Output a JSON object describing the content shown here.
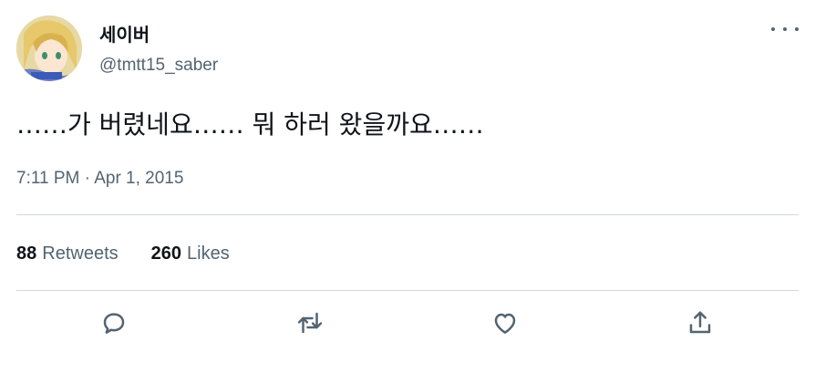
{
  "user": {
    "display_name": "세이버",
    "handle": "@tmtt15_saber",
    "avatar": "anime-character-avatar"
  },
  "tweet": {
    "text": "……가 버렸네요…… 뭐 하러 왔을까요……",
    "time": "7:11 PM",
    "separator": "·",
    "date": "Apr 1, 2015"
  },
  "stats": {
    "retweets_count": "88",
    "retweets_label": "Retweets",
    "likes_count": "260",
    "likes_label": "Likes"
  },
  "actions": [
    {
      "icon": "reply-icon"
    },
    {
      "icon": "retweet-icon"
    },
    {
      "icon": "like-icon"
    },
    {
      "icon": "share-icon"
    }
  ],
  "colors": {
    "text_primary": "#0f1419",
    "text_secondary": "#536471",
    "divider": "#cfd9de"
  }
}
